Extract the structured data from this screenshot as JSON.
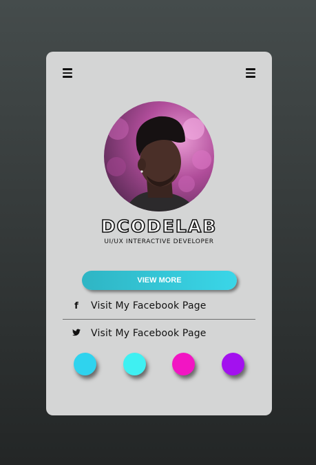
{
  "profile": {
    "name": "DCODELAB",
    "role": "UI/UX INTERACTIVE DEVELOPER"
  },
  "actions": {
    "view_more_label": "VIEW MORE"
  },
  "links": [
    {
      "icon": "facebook-icon",
      "glyph": "f",
      "label": "Visit My Facebook Page"
    },
    {
      "icon": "twitter-icon",
      "glyph": "🐦",
      "label": "Visit My Facebook Page"
    }
  ],
  "color_dots": [
    {
      "name": "cyan",
      "color": "#2fd3ee"
    },
    {
      "name": "aqua",
      "color": "#3ff0f2"
    },
    {
      "name": "magenta",
      "color": "#f215c3"
    },
    {
      "name": "purple",
      "color": "#a311ef"
    }
  ],
  "menu_icons": [
    "menu-icon",
    "menu-icon"
  ]
}
